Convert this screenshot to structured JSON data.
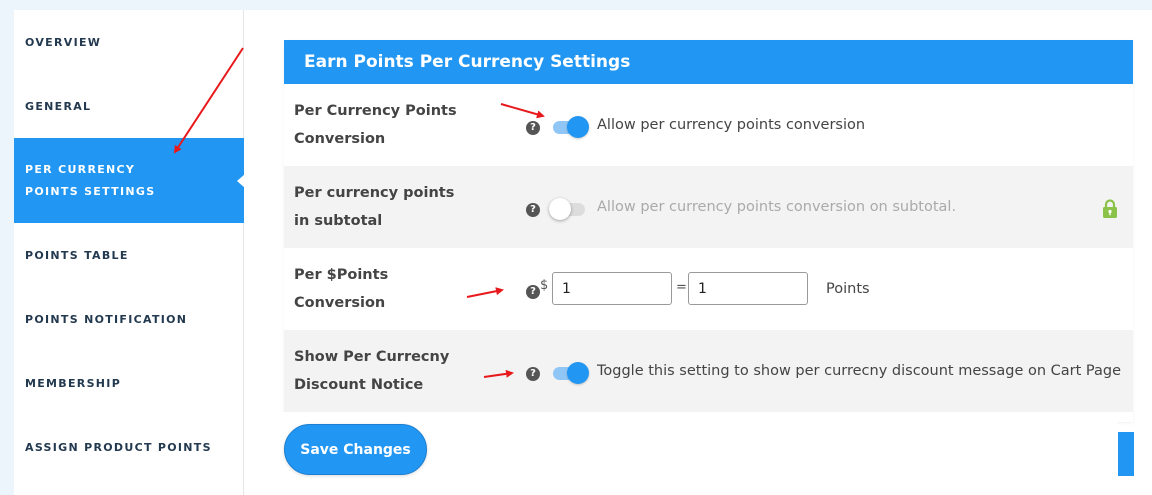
{
  "sidebar": {
    "items": [
      {
        "label": "OVERVIEW"
      },
      {
        "label": "GENERAL"
      },
      {
        "label": "PER CURRENCY POINTS SETTINGS",
        "active": true
      },
      {
        "label": "POINTS TABLE"
      },
      {
        "label": "POINTS NOTIFICATION"
      },
      {
        "label": "MEMBERSHIP"
      },
      {
        "label": "ASSIGN PRODUCT POINTS"
      }
    ]
  },
  "panel": {
    "title": "Earn Points Per Currency Settings",
    "rows": [
      {
        "label": "Per Currency Points Conversion",
        "toggle_on": true,
        "text": "Allow per currency points conversion"
      },
      {
        "label": "Per currency points in subtotal",
        "toggle_on": false,
        "text": "Allow per currency points conversion on subtotal.",
        "locked": true
      },
      {
        "label": "Per $Points Conversion",
        "currency_symbol": "$",
        "currency_value": "1",
        "equals": "=",
        "points_value": "1",
        "unit": "Points"
      },
      {
        "label": "Show Per Currecny Discount Notice",
        "toggle_on": true,
        "text": "Toggle this setting to show per currecny discount message on Cart Page"
      }
    ]
  },
  "actions": {
    "save_label": "Save Changes"
  },
  "colors": {
    "accent": "#2196f3",
    "lock": "#8bc34a",
    "annotation_arrow": "#e8191c"
  },
  "icons": {
    "help": "question-circle-icon",
    "lock": "lock-icon"
  }
}
